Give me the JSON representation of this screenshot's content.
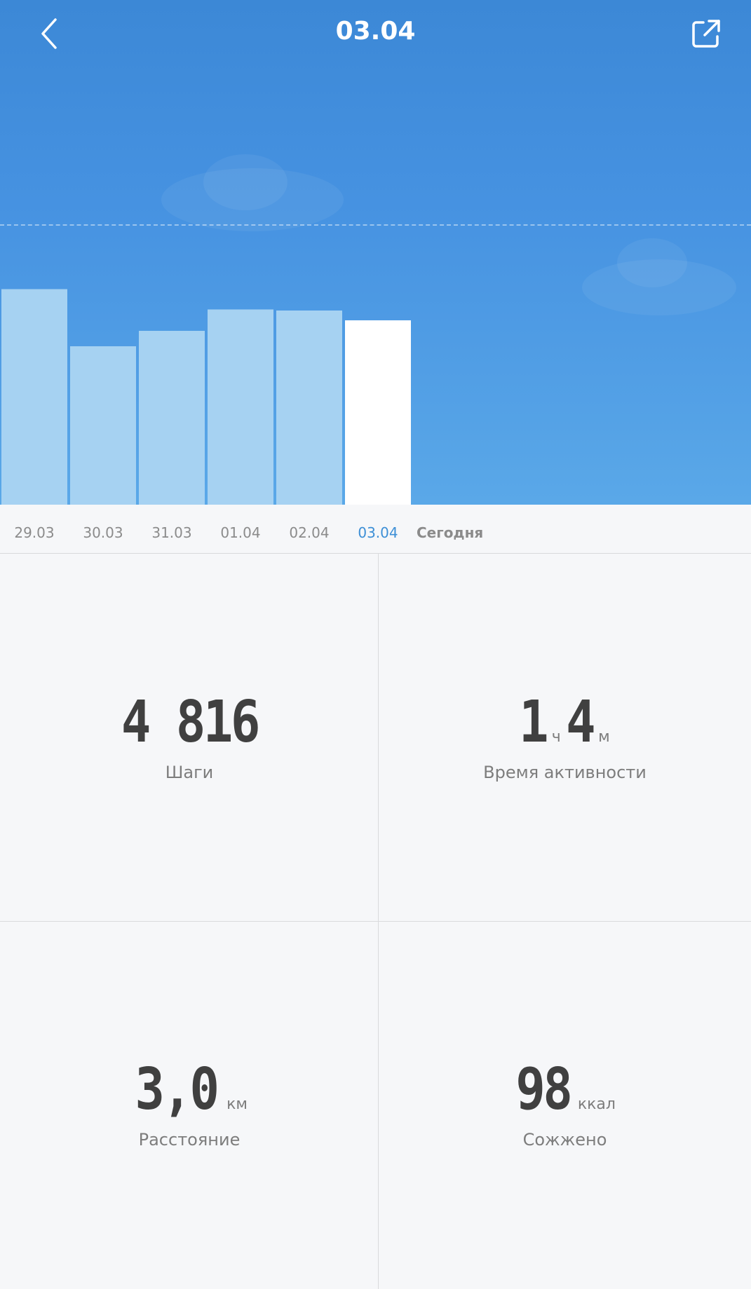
{
  "header": {
    "title": "03.04",
    "back_icon": "chevron-left-icon",
    "share_icon": "share-external-icon"
  },
  "colors": {
    "header_gradient_top": "#3c88d6",
    "header_gradient_bottom": "#5aa8e8",
    "bar": "#a6d2f2",
    "bar_selected": "#ffffff",
    "active_date": "#3d8fd6",
    "text_dark": "#404040",
    "text_muted": "#7d7d7d"
  },
  "chart_data": {
    "type": "bar",
    "categories": [
      "29.03",
      "30.03",
      "31.03",
      "01.04",
      "02.04",
      "03.04"
    ],
    "values": [
      6150,
      4520,
      4960,
      5570,
      5540,
      5260
    ],
    "selected_index": 5,
    "goal": 8000,
    "ylim": [
      0,
      10000
    ]
  },
  "date_strip": {
    "dates": [
      "29.03",
      "30.03",
      "31.03",
      "01.04",
      "02.04",
      "03.04"
    ],
    "active_index": 5,
    "today_label": "Сегодня"
  },
  "stats": {
    "steps": {
      "value": "4 816",
      "label": "Шаги"
    },
    "active_time": {
      "hours": "1",
      "hours_unit": "ч",
      "minutes": "4",
      "minutes_unit": "м",
      "label": "Время активности"
    },
    "distance": {
      "value": "3,0",
      "unit": "км",
      "label": "Расстояние"
    },
    "calories": {
      "value": "98",
      "unit": "ккал",
      "label": "Сожжено"
    }
  }
}
